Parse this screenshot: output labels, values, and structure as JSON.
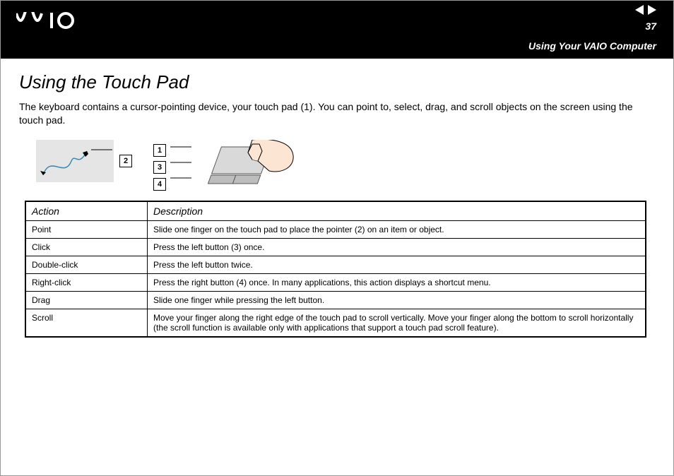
{
  "header": {
    "page_number": "37",
    "section_title": "Using Your VAIO Computer"
  },
  "title": "Using the Touch Pad",
  "intro": "The keyboard contains a cursor-pointing device, your touch pad (1). You can point to, select, drag, and scroll objects on the screen using the touch pad.",
  "callouts": {
    "fig1": "2",
    "fig2": [
      "1",
      "3",
      "4"
    ]
  },
  "table": {
    "headers": {
      "c1": "Action",
      "c2": "Description"
    },
    "rows": [
      {
        "action": "Point",
        "desc": "Slide one finger on the touch pad to place the pointer (2) on an item or object."
      },
      {
        "action": "Click",
        "desc": "Press the left button (3) once."
      },
      {
        "action": "Double-click",
        "desc": "Press the left button twice."
      },
      {
        "action": "Right-click",
        "desc": "Press the right button (4) once. In many applications, this action displays a shortcut menu."
      },
      {
        "action": "Drag",
        "desc": "Slide one finger while pressing the left button."
      },
      {
        "action": "Scroll",
        "desc": "Move your finger along the right edge of the touch pad to scroll vertically. Move your finger along the bottom to scroll horizontally (the scroll function is available only with applications that support a touch pad scroll feature)."
      }
    ]
  }
}
